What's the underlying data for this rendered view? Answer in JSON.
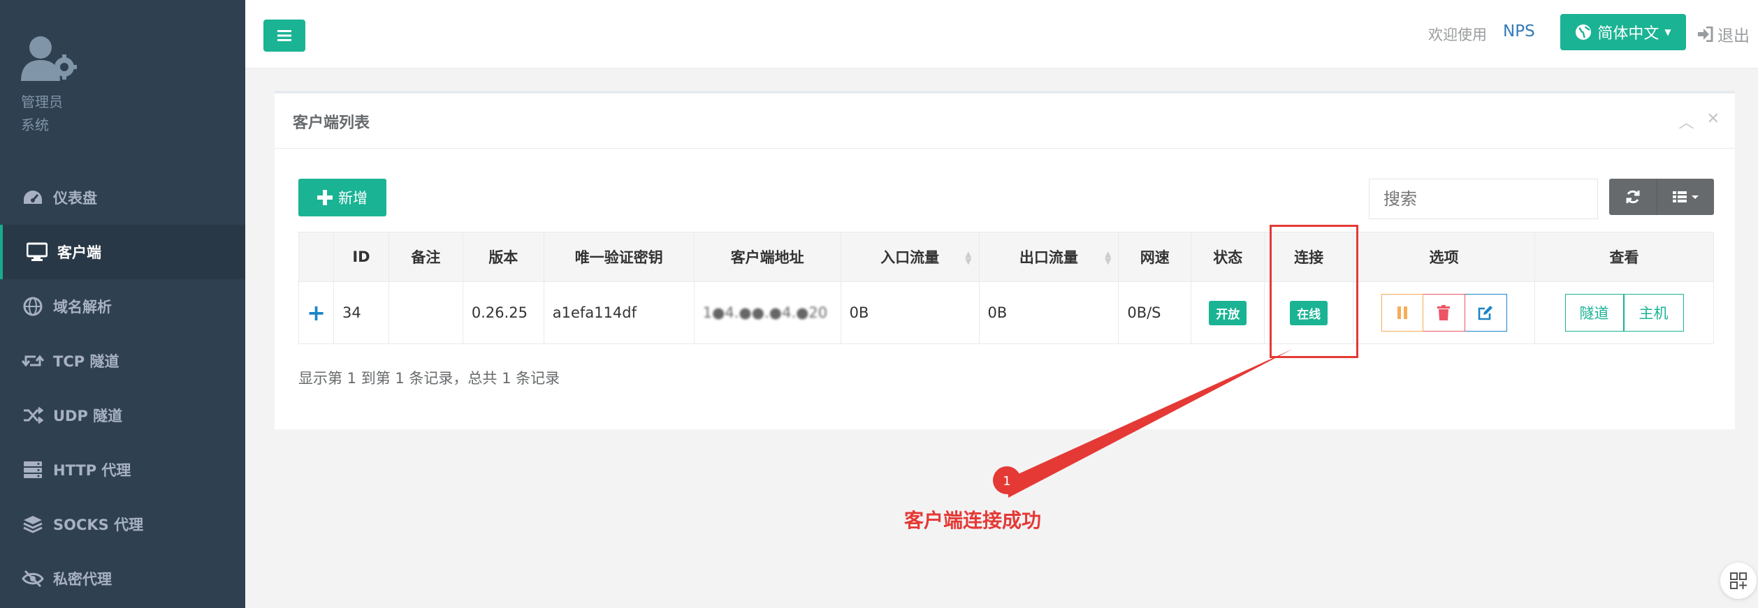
{
  "profile": {
    "name": "管理员",
    "role": "系统"
  },
  "nav": [
    {
      "label": "仪表盘",
      "icon": "dashboard-icon",
      "active": false
    },
    {
      "label": "客户端",
      "icon": "desktop-icon",
      "active": true
    },
    {
      "label": "域名解析",
      "icon": "globe-icon",
      "active": false
    },
    {
      "label": "TCP 隧道",
      "icon": "retweet-icon",
      "active": false
    },
    {
      "label": "UDP 隧道",
      "icon": "random-icon",
      "active": false
    },
    {
      "label": "HTTP 代理",
      "icon": "server-icon",
      "active": false
    },
    {
      "label": "SOCKS 代理",
      "icon": "layers-icon",
      "active": false
    },
    {
      "label": "私密代理",
      "icon": "eye-slash-icon",
      "active": false
    }
  ],
  "topbar": {
    "welcome": "欢迎使用",
    "brand": "NPS",
    "language": "简体中文",
    "logout": "退出"
  },
  "panel": {
    "title": "客户端列表",
    "add_label": "新增",
    "search_placeholder": "搜索"
  },
  "table": {
    "headers": [
      "ID",
      "备注",
      "版本",
      "唯一验证密钥",
      "客户端地址",
      "入口流量",
      "出口流量",
      "网速",
      "状态",
      "连接",
      "选项",
      "查看"
    ],
    "row": {
      "id": "34",
      "remark": "",
      "version": "0.26.25",
      "key": "a1efa114df",
      "address": "1●4.●●.●4.●20",
      "inlet_flow": "0B",
      "export_flow": "0B",
      "speed": "0B/S",
      "status": "开放",
      "connection": "在线",
      "view_tunnel": "隧道",
      "view_host": "主机"
    }
  },
  "pager": {
    "info": "显示第 1 到第 1 条记录，总共 1 条记录"
  },
  "annotation": {
    "marker": "1",
    "label": "客户端连接成功"
  },
  "colors": {
    "primary": "#1ab394",
    "sidebar": "#2f4050",
    "annotation": "#e53935",
    "warning": "#f8ac59",
    "danger": "#ed5565",
    "info": "#1c84c6"
  }
}
